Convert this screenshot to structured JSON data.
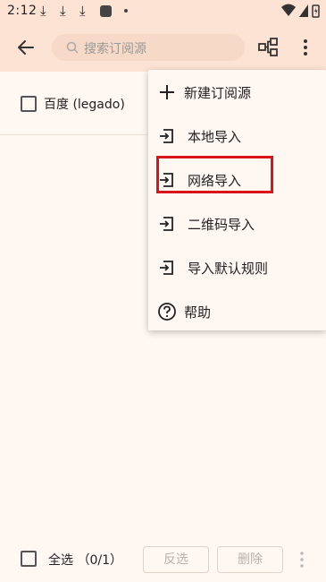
{
  "status_bar": {
    "time": "2:12"
  },
  "app_bar": {
    "search_placeholder": "搜索订阅源"
  },
  "list": {
    "items": [
      {
        "label": "百度 (legado)"
      }
    ]
  },
  "menu": {
    "items": [
      {
        "label": "新建订阅源",
        "icon": "plus-icon"
      },
      {
        "label": "本地导入",
        "icon": "import-icon"
      },
      {
        "label": "网络导入",
        "icon": "import-icon",
        "highlighted": true
      },
      {
        "label": "二维码导入",
        "icon": "import-icon"
      },
      {
        "label": "导入默认规则",
        "icon": "import-icon"
      },
      {
        "label": "帮助",
        "icon": "help-icon"
      }
    ]
  },
  "bottom_bar": {
    "select_all_label": "全选 （0/1）",
    "invert_label": "反选",
    "delete_label": "删除"
  },
  "colors": {
    "app_bar": "#fde3d3",
    "background": "#fff7f2",
    "highlight": "#d9131b"
  }
}
